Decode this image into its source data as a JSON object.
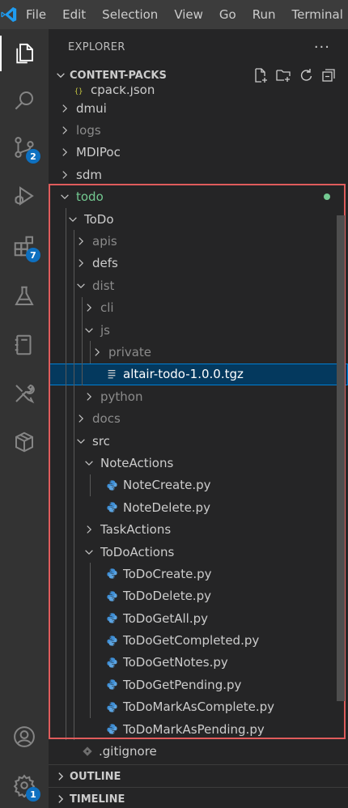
{
  "menubar": {
    "items": [
      "File",
      "Edit",
      "Selection",
      "View",
      "Go",
      "Run",
      "Terminal"
    ]
  },
  "activity_bar": {
    "items": [
      {
        "name": "explorer-icon",
        "badge": ""
      },
      {
        "name": "search-icon",
        "badge": ""
      },
      {
        "name": "source-control-icon",
        "badge": "2"
      },
      {
        "name": "run-debug-icon",
        "badge": ""
      },
      {
        "name": "extensions-icon",
        "badge": "7"
      },
      {
        "name": "testing-flask-icon",
        "badge": ""
      },
      {
        "name": "notebook-icon",
        "badge": ""
      },
      {
        "name": "tools-icon",
        "badge": ""
      },
      {
        "name": "package-icon",
        "badge": ""
      }
    ],
    "accounts_icon": "account-icon",
    "settings_badge": "1"
  },
  "explorer": {
    "title": "EXPLORER",
    "more": "···",
    "section_title": "CONTENT-PACKS",
    "tree": [
      {
        "label": "cpack.json",
        "kind": "json",
        "depth": 1,
        "state": "partial"
      },
      {
        "label": "dmui",
        "kind": "folder",
        "depth": 1,
        "state": "collapsed"
      },
      {
        "label": "logs",
        "kind": "folder",
        "depth": 1,
        "state": "collapsed",
        "style": "dim"
      },
      {
        "label": "MDIPoc",
        "kind": "folder",
        "depth": 1,
        "state": "collapsed"
      },
      {
        "label": "sdm",
        "kind": "folder",
        "depth": 1,
        "state": "collapsed"
      },
      {
        "label": "todo",
        "kind": "folder",
        "depth": 1,
        "state": "expanded",
        "style": "green",
        "dot": true
      },
      {
        "label": "ToDo",
        "kind": "folder",
        "depth": 2,
        "state": "expanded"
      },
      {
        "label": "apis",
        "kind": "folder",
        "depth": 3,
        "state": "collapsed",
        "style": "dim"
      },
      {
        "label": "defs",
        "kind": "folder",
        "depth": 3,
        "state": "collapsed"
      },
      {
        "label": "dist",
        "kind": "folder",
        "depth": 3,
        "state": "expanded",
        "style": "dim"
      },
      {
        "label": "cli",
        "kind": "folder",
        "depth": 4,
        "state": "collapsed",
        "style": "dim"
      },
      {
        "label": "js",
        "kind": "folder",
        "depth": 4,
        "state": "expanded",
        "style": "dim"
      },
      {
        "label": "private",
        "kind": "folder",
        "depth": 5,
        "state": "collapsed",
        "style": "dim"
      },
      {
        "label": "altair-todo-1.0.0.tgz",
        "kind": "file",
        "depth": 5,
        "selected": true
      },
      {
        "label": "python",
        "kind": "folder",
        "depth": 4,
        "state": "collapsed",
        "style": "dim"
      },
      {
        "label": "docs",
        "kind": "folder",
        "depth": 3,
        "state": "collapsed",
        "style": "dim"
      },
      {
        "label": "src",
        "kind": "folder",
        "depth": 3,
        "state": "expanded"
      },
      {
        "label": "NoteActions",
        "kind": "folder",
        "depth": 4,
        "state": "expanded"
      },
      {
        "label": "NoteCreate.py",
        "kind": "python",
        "depth": 5
      },
      {
        "label": "NoteDelete.py",
        "kind": "python",
        "depth": 5
      },
      {
        "label": "TaskActions",
        "kind": "folder",
        "depth": 4,
        "state": "collapsed"
      },
      {
        "label": "ToDoActions",
        "kind": "folder",
        "depth": 4,
        "state": "expanded"
      },
      {
        "label": "ToDoCreate.py",
        "kind": "python",
        "depth": 5
      },
      {
        "label": "ToDoDelete.py",
        "kind": "python",
        "depth": 5
      },
      {
        "label": "ToDoGetAll.py",
        "kind": "python",
        "depth": 5
      },
      {
        "label": "ToDoGetCompleted.py",
        "kind": "python",
        "depth": 5
      },
      {
        "label": "ToDoGetNotes.py",
        "kind": "python",
        "depth": 5
      },
      {
        "label": "ToDoGetPending.py",
        "kind": "python",
        "depth": 5
      },
      {
        "label": "ToDoMarkAsComplete.py",
        "kind": "python",
        "depth": 5
      },
      {
        "label": "ToDoMarkAsPending.py",
        "kind": "python",
        "depth": 5
      },
      {
        "label": ".gitignore",
        "kind": "git",
        "depth": 2
      }
    ],
    "outline_title": "OUTLINE",
    "timeline_title": "TIMELINE"
  },
  "colors": {
    "accent_badge": "#0e70c0",
    "git_added": "#73c991",
    "selection": "#04395e",
    "highlight_box": "#e05c5c",
    "python_icon": "#3f8fd6"
  }
}
